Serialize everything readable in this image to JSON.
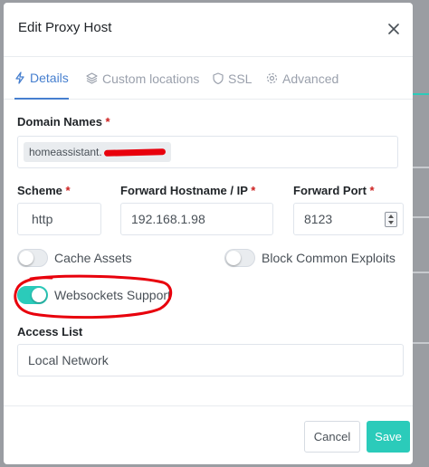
{
  "modal": {
    "title": "Edit Proxy Host"
  },
  "tabs": [
    {
      "label": "Details",
      "icon": "lightning-icon",
      "active": true
    },
    {
      "label": "Custom locations",
      "icon": "layers-icon",
      "active": false
    },
    {
      "label": "SSL",
      "icon": "shield-icon",
      "active": false
    },
    {
      "label": "Advanced",
      "icon": "gear-icon",
      "active": false
    }
  ],
  "form": {
    "domain_names": {
      "label": "Domain Names",
      "required_mark": "*",
      "tag_value": "homeassistant."
    },
    "scheme": {
      "label": "Scheme",
      "required_mark": "*",
      "value": "http"
    },
    "forward_hostname": {
      "label": "Forward Hostname / IP",
      "required_mark": "*",
      "value": "192.168.1.98"
    },
    "forward_port": {
      "label": "Forward Port",
      "required_mark": "*",
      "value": "8123"
    },
    "toggles": {
      "cache_assets": {
        "label": "Cache Assets",
        "on": false
      },
      "block_exploits": {
        "label": "Block Common Exploits",
        "on": false
      },
      "websockets": {
        "label": "Websockets Support",
        "on": true
      }
    },
    "access_list": {
      "label": "Access List",
      "value": "Local Network"
    }
  },
  "footer": {
    "cancel_label": "Cancel",
    "save_label": "Save"
  },
  "colors": {
    "accent_blue": "#467fcf",
    "teal": "#2bcbba",
    "annotation_red": "#e8000c",
    "required_red": "#cd201f"
  }
}
